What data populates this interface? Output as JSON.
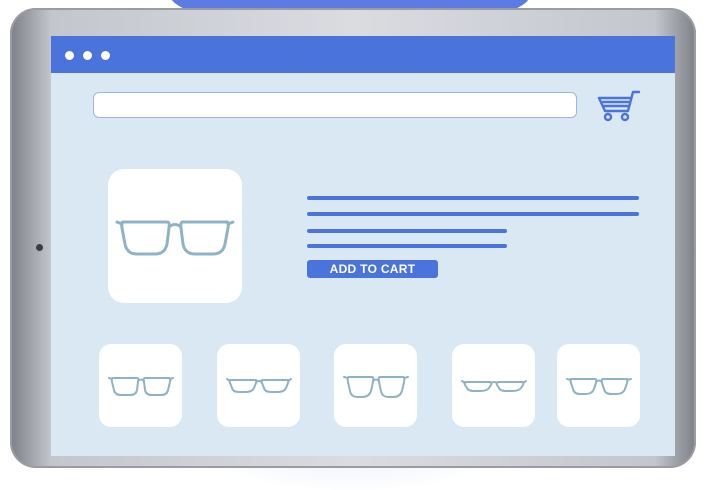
{
  "colors": {
    "accent": "#4a73dc",
    "screen_background": "#d9e8f2",
    "card_background": "#ffffff",
    "glasses_frame": "#8fb3c6"
  },
  "window": {
    "controls": [
      "window-dot",
      "window-dot",
      "window-dot"
    ]
  },
  "header": {
    "search_value": "",
    "cart_icon": "shopping-cart-icon"
  },
  "product": {
    "image_icon": "glasses-icon",
    "add_to_cart_label": "ADD TO CART"
  },
  "thumbnails": [
    {
      "icon": "glasses-icon"
    },
    {
      "icon": "glasses-icon"
    },
    {
      "icon": "glasses-icon"
    },
    {
      "icon": "glasses-icon"
    },
    {
      "icon": "glasses-icon"
    }
  ]
}
